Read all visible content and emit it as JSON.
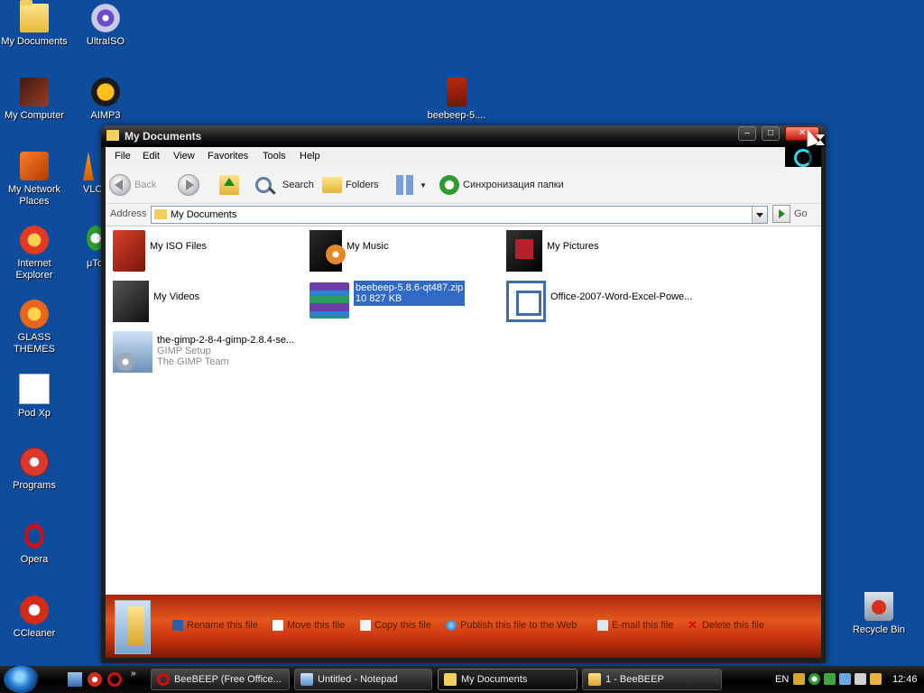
{
  "desktop": {
    "icons": [
      {
        "label": "My Documents"
      },
      {
        "label": "UltraISO"
      },
      {
        "label": "My Computer"
      },
      {
        "label": "AIMP3"
      },
      {
        "label": "My Network Places"
      },
      {
        "label": "VLC"
      },
      {
        "label": "Internet Explorer"
      },
      {
        "label": "μTo"
      },
      {
        "label": "GLASS THEMES"
      },
      {
        "label": "Pod Xp"
      },
      {
        "label": "Programs"
      },
      {
        "label": "Opera"
      },
      {
        "label": "CCleaner"
      },
      {
        "label": "beebeep-5...."
      },
      {
        "label": "Recycle Bin"
      }
    ]
  },
  "window": {
    "title": "My Documents",
    "menu": [
      "File",
      "Edit",
      "View",
      "Favorites",
      "Tools",
      "Help"
    ],
    "toolbar": {
      "back": "Back",
      "search": "Search",
      "folders": "Folders",
      "sync": "Синхронизация папки"
    },
    "address": {
      "label": "Address",
      "value": "My Documents",
      "go": "Go"
    },
    "files": [
      {
        "name": "My ISO Files"
      },
      {
        "name": "My Music"
      },
      {
        "name": "My Pictures"
      },
      {
        "name": "My Videos"
      },
      {
        "name": "beebeep-5.8.6-qt487.zip",
        "sub": "10 827 KB"
      },
      {
        "name": "Office-2007-Word-Excel-Powe..."
      },
      {
        "name": "the-gimp-2-8-4-gimp-2.8.4-se...",
        "sub": "GIMP Setup",
        "sub2": "The GIMP Team"
      }
    ],
    "tasks": [
      "Rename this file",
      "Move this file",
      "Copy this file",
      "Publish this file to the Web",
      "E-mail this file",
      "Delete this file"
    ]
  },
  "taskbar": {
    "buttons": [
      "BeeBEEP (Free Office...",
      "Untitled - Notepad",
      "My Documents",
      "1 - BeeBEEP"
    ],
    "language": "EN",
    "clock": "12:46"
  }
}
